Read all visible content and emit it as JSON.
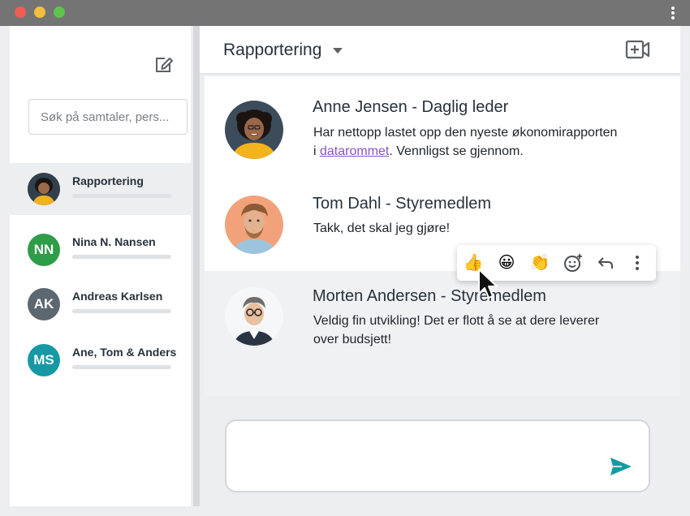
{
  "sidebar": {
    "search_placeholder": "Søk på samtaler, pers...",
    "conversations": [
      {
        "name": "Rapportering",
        "avatar": "photo"
      },
      {
        "name": "Nina N. Nansen",
        "initials": "NN",
        "color": "#2e9d48"
      },
      {
        "name": "Andreas Karlsen",
        "initials": "AK",
        "color": "#5c6770"
      },
      {
        "name": "Ane, Tom & Anders",
        "initials": "MS",
        "color": "#1699a5"
      }
    ]
  },
  "header": {
    "title": "Rapportering"
  },
  "messages": [
    {
      "author": "Anne Jensen - Daglig leder",
      "line1": "Har nettopp lastet opp den nyeste økonomirapporten",
      "line2_prefix": "i ",
      "link": "datarommet",
      "line2_suffix": ". Vennligst se gjennom."
    },
    {
      "author": "Tom Dahl - Styremedlem",
      "line1": "Takk, det skal jeg gjøre!"
    },
    {
      "author": "Morten Andersen - Styremedlem",
      "line1": "Veldig fin utvikling! Det er flott å se at dere leverer",
      "line2": "over budsjett!"
    }
  ],
  "reactions": {
    "thumbs_up": "👍",
    "smile": "😀",
    "clap": "👏"
  },
  "colors": {
    "accent": "#1699a5",
    "link": "#8a52c9"
  }
}
